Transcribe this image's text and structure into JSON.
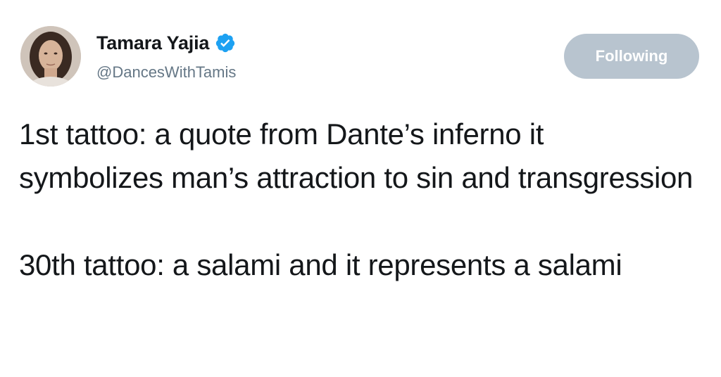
{
  "author": {
    "display_name": "Tamara Yajia",
    "handle": "@DancesWithTamis",
    "verified": true,
    "verified_icon": "verified-badge-icon",
    "verified_color": "#1da1f2"
  },
  "follow_button": {
    "label": "Following",
    "color": "#b8c4cf"
  },
  "tweet": {
    "paragraph_1": "1st tattoo: a quote from Dante’s inferno it symbolizes man’s attraction to sin and transgression",
    "paragraph_2": "30th tattoo: a salami and it represents a salami"
  }
}
